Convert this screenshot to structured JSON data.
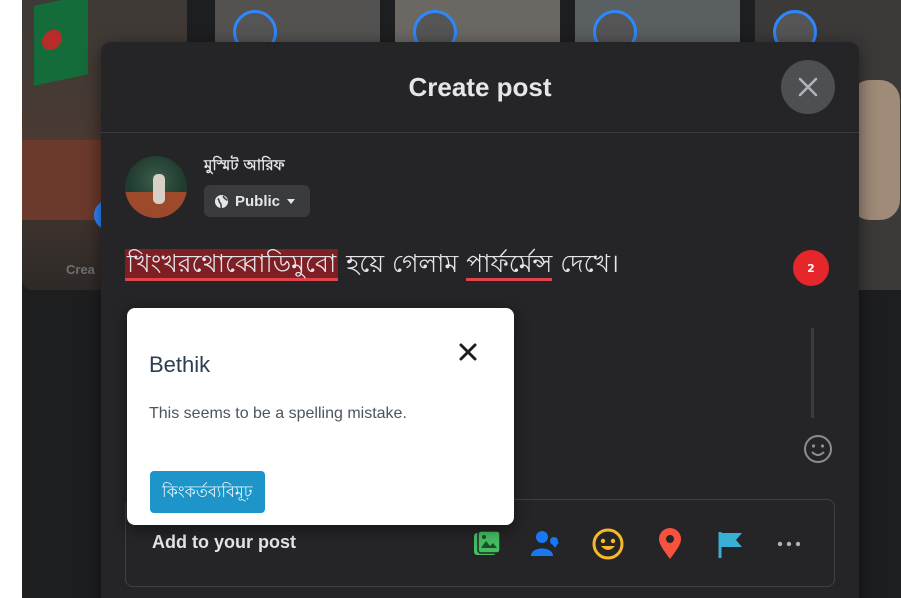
{
  "background": {
    "create_story_label": "Crea"
  },
  "modal": {
    "title": "Create post",
    "author": {
      "name": "মুস্মিট আরিফ"
    },
    "privacy": {
      "label": "Public"
    },
    "post": {
      "misspelled_word": "খিংখরথোব্বোডিমুবো",
      "text_part2": " হয়ে গেলাম ",
      "underlined_word": "পার্ফর্মেন্স",
      "text_part3": " দেখে।",
      "error_count": "2"
    },
    "add_to_post": {
      "label": "Add to your post",
      "tools": [
        {
          "icon": "photo-icon",
          "color": "#45bd62"
        },
        {
          "icon": "tag-people-icon",
          "color": "#1877f2"
        },
        {
          "icon": "feeling-icon",
          "color": "#f7b928"
        },
        {
          "icon": "location-icon",
          "color": "#f5533d"
        },
        {
          "icon": "flag-icon",
          "color": "#39afd5"
        },
        {
          "icon": "more-icon",
          "color": "#b0b3b8"
        }
      ]
    }
  },
  "spell_popup": {
    "title": "Bethik",
    "message": "This seems to be a spelling mistake.",
    "suggestion": "কিংকর্তব্যবিমূঢ়"
  },
  "colors": {
    "modal_bg": "#252527",
    "error_red": "#e0434b",
    "suggestion_blue": "#1d95c9"
  }
}
